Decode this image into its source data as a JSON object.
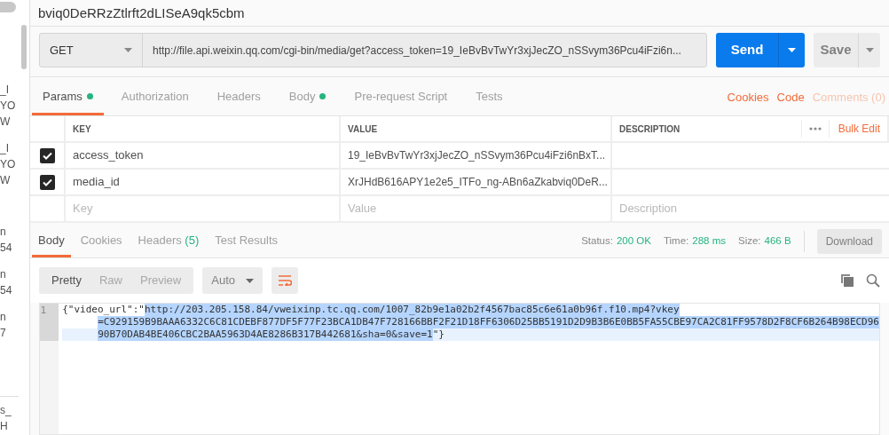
{
  "sidebar": {
    "toggle_on": false,
    "groups": [
      {
        "lines": [
          "_I",
          "YO",
          "W"
        ]
      },
      {
        "lines": [
          "_I",
          "YO",
          "W"
        ]
      },
      {
        "lines": [
          "n",
          "54"
        ]
      },
      {
        "lines": [
          "n",
          "54"
        ]
      },
      {
        "lines": [
          "n",
          "7"
        ]
      },
      {
        "lines": [
          "s_",
          "H"
        ]
      }
    ]
  },
  "request": {
    "title": "bviq0DeRRzZtlrft2dLISeA9qk5cbm",
    "method": "GET",
    "url": "http://file.api.weixin.qq.com/cgi-bin/media/get?access_token=19_IeBvBvTwYr3xjJecZO_nSSvym36Pcu4iFzi6n...",
    "send": "Send",
    "save": "Save"
  },
  "request_tabs": [
    {
      "label": "Params",
      "dot": true,
      "selected": true
    },
    {
      "label": "Authorization",
      "dot": false,
      "selected": false
    },
    {
      "label": "Headers",
      "dot": false,
      "selected": false
    },
    {
      "label": "Body",
      "dot": true,
      "selected": false
    },
    {
      "label": "Pre-request Script",
      "dot": false,
      "selected": false
    },
    {
      "label": "Tests",
      "dot": false,
      "selected": false
    }
  ],
  "request_links": [
    "Cookies",
    "Code",
    "Comments (0)"
  ],
  "params_table": {
    "columns": [
      "KEY",
      "VALUE",
      "DESCRIPTION"
    ],
    "bulk_edit": "Bulk Edit",
    "rows": [
      {
        "checked": true,
        "key": "access_token",
        "value": "19_IeBvBvTwYr3xjJecZO_nSSvym36Pcu4iFzi6nBxT..."
      },
      {
        "checked": true,
        "key": "media_id",
        "value": "XrJHdB616APY1e2e5_ITFo_ng-ABn6aZkabviq0DeR..."
      }
    ],
    "new_row": {
      "key": {
        "placeholder": "Key"
      },
      "value": {
        "placeholder": "Value"
      },
      "description": {
        "placeholder": "Description"
      }
    }
  },
  "response_tabs": [
    {
      "label": "Body",
      "selected": true
    },
    {
      "label": "Cookies",
      "selected": false
    },
    {
      "label": "Headers",
      "count": "(5)",
      "selected": false
    },
    {
      "label": "Test Results",
      "selected": false
    }
  ],
  "status": [
    {
      "label": "Status:",
      "value": "200 OK"
    },
    {
      "label": "Time:",
      "value": "288 ms"
    },
    {
      "label": "Size:",
      "value": "466 B"
    }
  ],
  "download": "Download",
  "view_modes": [
    {
      "label": "Pretty",
      "selected": true
    },
    {
      "label": "Raw",
      "selected": false
    },
    {
      "label": "Preview",
      "selected": false
    }
  ],
  "format": "Auto",
  "code": {
    "line_number": "1",
    "rows": [
      {
        "plain_before": "{\"video_url\":\"",
        "highlighted": "http://203.205.158.84/vweixinp.tc.qq.com/1007_82b9e1a02b2f4567bac85c6e61a0b96f.f10.mp4?vkey"
      },
      {
        "highlighted": "=C929159B9BAAA6332C6C81CDEBF877DF5F77F23BCA1DB47F728166BBF2F21D18FF6306D25BB5191D2D9B3B6E0BB5FA55CBE97CA2C81FF9578D2F8CF6B264B98ECD96"
      },
      {
        "highlighted": "90B70DAB4BE406CBC2BAA5963D4AE8286B317B442681&sha=0&save=1",
        "plain_after": "\"}"
      }
    ]
  }
}
